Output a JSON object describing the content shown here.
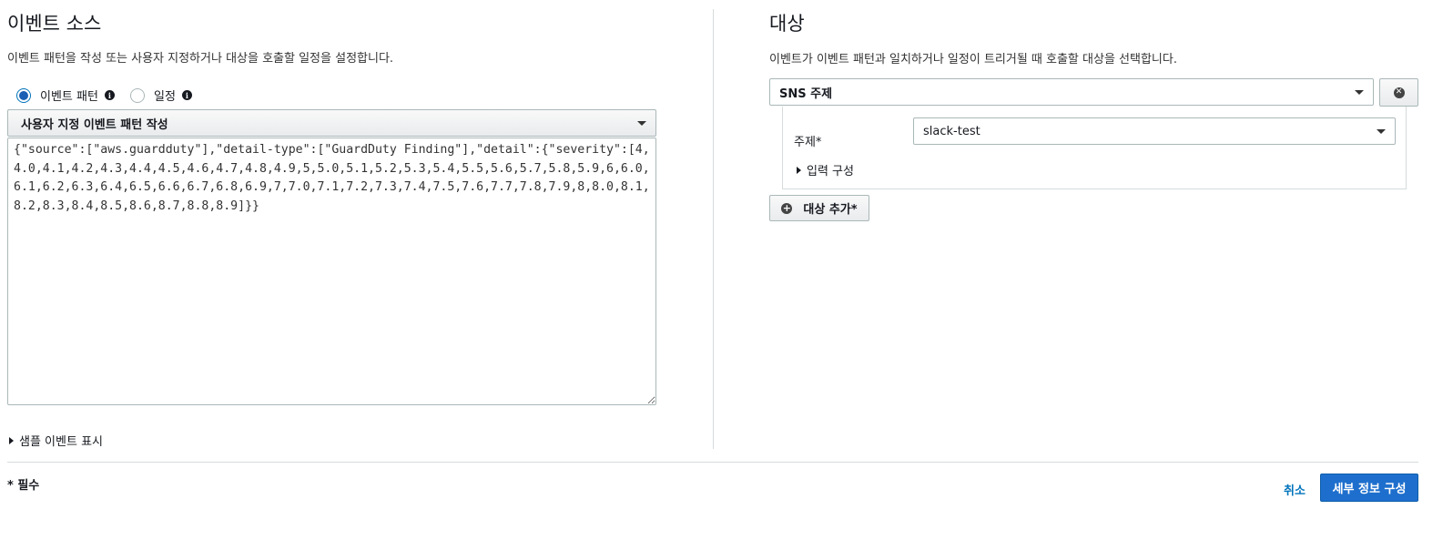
{
  "event_source": {
    "title": "이벤트 소스",
    "description": "이벤트 패턴을 작성 또는 사용자 지정하거나 대상을 호출할 일정을 설정합니다.",
    "radio_event_pattern": "이벤트 패턴",
    "radio_schedule": "일정",
    "selected_radio": "event_pattern",
    "pattern_select": "사용자 지정 이벤트 패턴 작성",
    "pattern_text": "{\"source\":[\"aws.guardduty\"],\"detail-type\":[\"GuardDuty Finding\"],\"detail\":{\"severity\":[4,4.0,4.1,4.2,4.3,4.4,4.5,4.6,4.7,4.8,4.9,5,5.0,5.1,5.2,5.3,5.4,5.5,5.6,5.7,5.8,5.9,6,6.0,6.1,6.2,6.3,6.4,6.5,6.6,6.7,6.8,6.9,7,7.0,7.1,7.2,7.3,7.4,7.5,7.6,7.7,7.8,7.9,8,8.0,8.1,8.2,8.3,8.4,8.5,8.6,8.7,8.8,8.9]}}",
    "show_sample": "샘플 이벤트 표시"
  },
  "targets": {
    "title": "대상",
    "description": "이벤트가 이벤트 패턴과 일치하거나 일정이 트리거될 때 호출할 대상을 선택합니다.",
    "target_type": "SNS 주제",
    "topic_label": "주제*",
    "topic_value": "slack-test",
    "configure_input": "입력 구성",
    "add_target": "대상 추가*"
  },
  "footer": {
    "required_note": "* 필수",
    "cancel": "취소",
    "configure_details": "세부 정보 구성"
  },
  "icons": {
    "info": "info-icon",
    "caret": "chevron-down-icon",
    "remove": "remove-circle-icon",
    "add": "plus-circle-icon"
  },
  "colors": {
    "primary": "#1e6fcd",
    "link": "#0073bb",
    "border": "#aab7b8"
  }
}
